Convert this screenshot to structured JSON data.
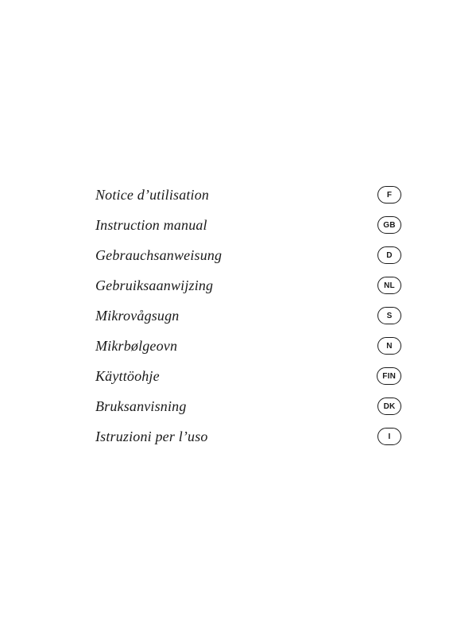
{
  "items": [
    {
      "label": "Notice d’utilisation",
      "badge": "F"
    },
    {
      "label": "Instruction manual",
      "badge": "GB"
    },
    {
      "label": "Gebrauchsanweisung",
      "badge": "D"
    },
    {
      "label": "Gebruiksaanwijzing",
      "badge": "NL"
    },
    {
      "label": "Mikrovågsugn",
      "badge": "S"
    },
    {
      "label": "Mikrbølgeovn",
      "badge": "N"
    },
    {
      "label": "Käyttöohje",
      "badge": "FIN"
    },
    {
      "label": "Bruksanvisning",
      "badge": "DK"
    },
    {
      "label": "Istruzioni per l’uso",
      "badge": "I"
    }
  ]
}
